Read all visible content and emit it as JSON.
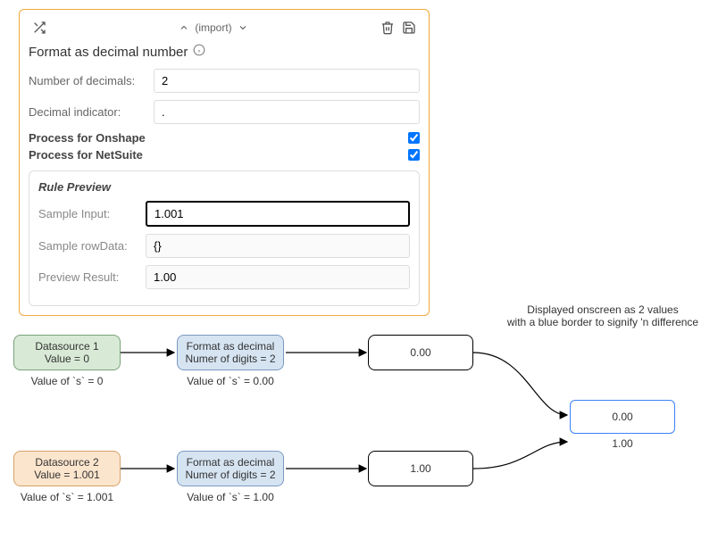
{
  "panel": {
    "import_label": "(import)",
    "title": "Format as decimal number",
    "fields": {
      "num_decimals_label": "Number of decimals:",
      "num_decimals_value": "2",
      "decimal_indicator_label": "Decimal indicator:",
      "decimal_indicator_value": "."
    },
    "process_onshape": "Process for Onshape",
    "process_netsuite": "Process for NetSuite",
    "preview": {
      "title": "Rule Preview",
      "sample_input_label": "Sample Input:",
      "sample_input_value": "1.001",
      "sample_rowdata_label": "Sample rowData:",
      "sample_rowdata_value": "{}",
      "preview_result_label": "Preview Result:",
      "preview_result_value": "1.00"
    }
  },
  "icons": {
    "shuffle": "shuffle",
    "up": "up",
    "down": "down",
    "trash": "trash",
    "save": "save",
    "info": "info"
  },
  "diagram": {
    "annotation_line1": "Displayed onscreen as 2 values",
    "annotation_line2": "with a blue border to signify 'n difference",
    "ds1": {
      "title": "Datasource 1",
      "value": "Value = 0"
    },
    "ds1_caption": "Value of `s` = 0",
    "fmt1": {
      "title": "Format as decimal",
      "value": "Numer of digits = 2"
    },
    "fmt1_caption": "Value of `s` = 0.00",
    "out1": "0.00",
    "ds2": {
      "title": "Datasource 2",
      "value": "Value = 1.001"
    },
    "ds2_caption": "Value of `s` = 1.001",
    "fmt2": {
      "title": "Format as decimal",
      "value": "Numer of digits = 2"
    },
    "fmt2_caption": "Value of `s` = 1.00",
    "out2": "1.00",
    "merged_top": "0.00",
    "merged_bottom": "1.00"
  }
}
